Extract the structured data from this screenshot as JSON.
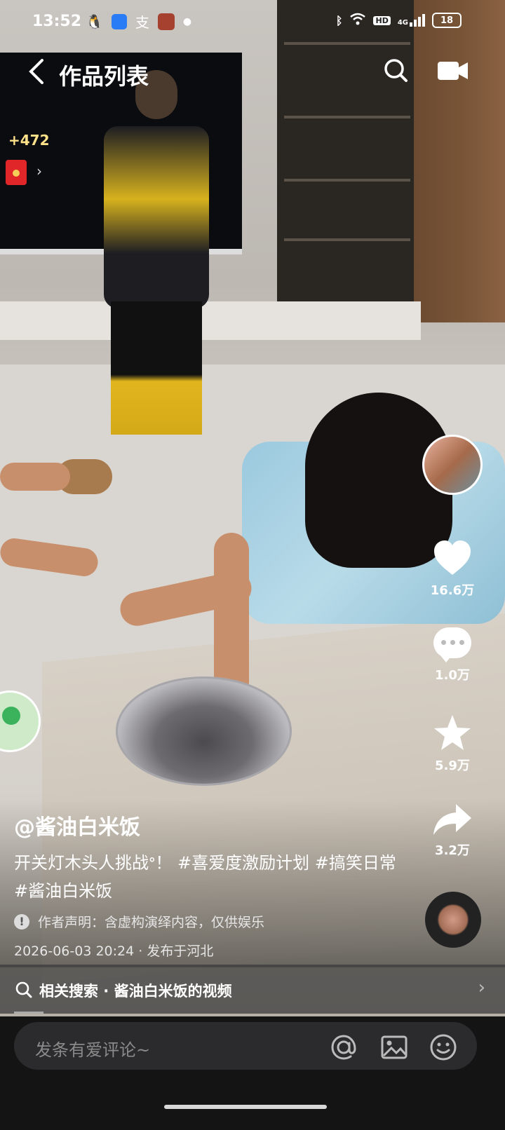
{
  "status_bar": {
    "time": "13:52",
    "left_icons": [
      "qq-icon",
      "browser-icon",
      "alipay-icon",
      "game-icon",
      "dot-icon"
    ],
    "right_icons": [
      "bluetooth-icon",
      "wifi-icon",
      "hd-icon",
      "4g-signal-icon"
    ],
    "hd_label": "HD",
    "network_label": "4G",
    "battery_level": "18"
  },
  "topbar": {
    "title": "作品列表",
    "back_icon": "chevron-left-icon",
    "search_icon": "search-icon",
    "camera_icon": "camera-icon"
  },
  "coin_widget": {
    "points": "+472",
    "chevron": "›"
  },
  "sidebar": {
    "like_count": "16.6万",
    "comment_count": "1.0万",
    "favorite_count": "5.9万",
    "share_count": "3.2万"
  },
  "caption": {
    "author": "@酱油白米饭",
    "description": "开关灯木头人挑战ᐤ！ #喜爱度激励计划 #搞笑日常 #酱油白米饭",
    "notice": "作者声明：含虚构演绎内容，仅供娱乐",
    "notice_icon": "!",
    "date_location": "2026-06-03 20:24 · 发布于河北"
  },
  "related": {
    "label": "相关搜索 · 酱油白米饭的视频",
    "chevron": "›"
  },
  "comment_bar": {
    "placeholder": "发条有爱评论~"
  },
  "colors": {
    "accent_coin": "#ffe18a",
    "red_packet": "#e1262a",
    "bottom_bg": "#141414",
    "comment_box_bg": "#2b2b2d"
  }
}
